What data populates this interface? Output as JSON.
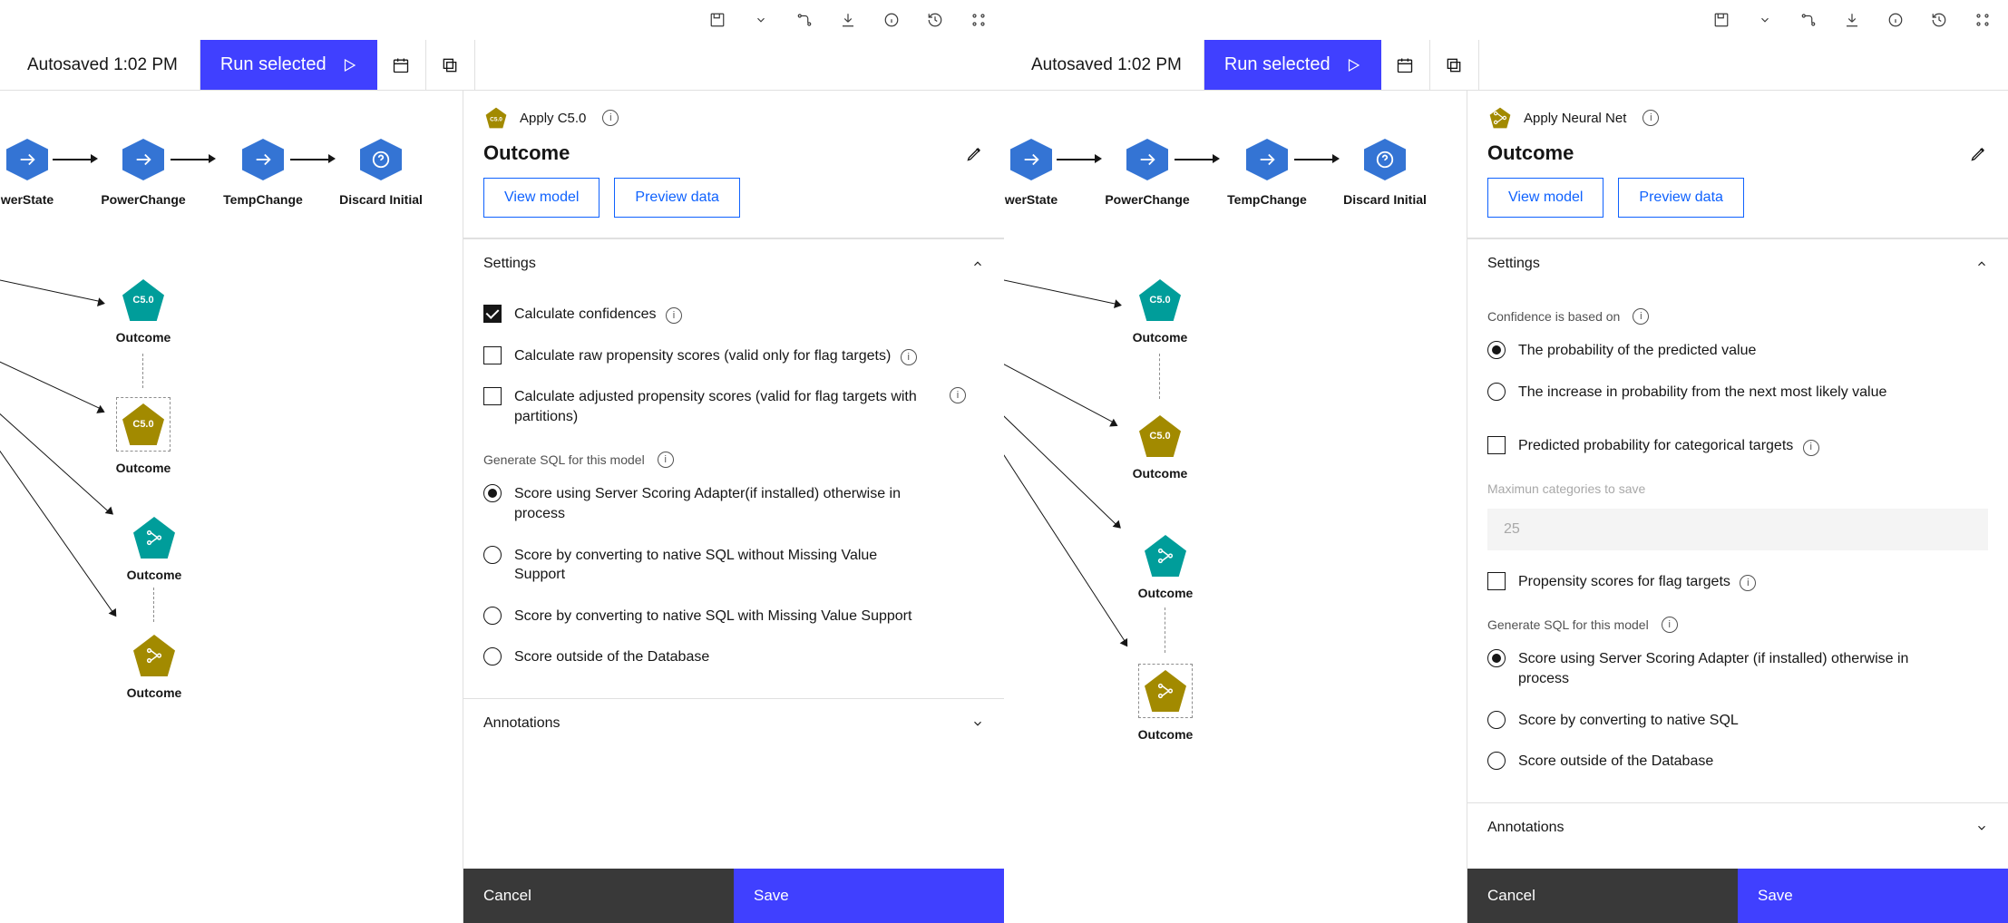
{
  "toolbar": {
    "autosave": "Autosaved 1:02 PM",
    "run": "Run selected"
  },
  "canvas": {
    "rownodes": [
      "werState",
      "PowerChange",
      "TempChange",
      "Discard Initial"
    ],
    "out": "Outcome",
    "c50": "C5.0"
  },
  "panelA": {
    "model": "Apply C5.0",
    "heading": "Outcome",
    "view": "View model",
    "preview": "Preview data",
    "settings": "Settings",
    "ck1": "Calculate confidences",
    "ck2": "Calculate raw propensity scores (valid only for flag targets)",
    "ck3": "Calculate adjusted propensity scores (valid for flag targets with partitions)",
    "gen": "Generate SQL for this model",
    "r1": "Score using Server Scoring Adapter(if installed) otherwise in process",
    "r2": "Score by converting to native SQL without Missing Value Support",
    "r3": "Score by converting to native SQL with Missing Value Support",
    "r4": "Score outside of the Database",
    "ann": "Annotations",
    "cancel": "Cancel",
    "save": "Save"
  },
  "panelB": {
    "model": "Apply Neural Net",
    "heading": "Outcome",
    "view": "View model",
    "preview": "Preview data",
    "settings": "Settings",
    "conf": "Confidence is based on",
    "rb1": "The probability of the predicted value",
    "rb2": "The increase in probability from the next most likely value",
    "ck1": "Predicted probability for categorical targets",
    "max": "Maximun categories to save",
    "maxv": "25",
    "ck2": "Propensity scores for flag targets",
    "gen": "Generate SQL for this model",
    "r1": "Score using Server Scoring Adapter (if installed) otherwise in process",
    "r2": "Score by converting to native SQL",
    "r3": "Score outside of the Database",
    "ann": "Annotations",
    "cancel": "Cancel",
    "save": "Save"
  }
}
